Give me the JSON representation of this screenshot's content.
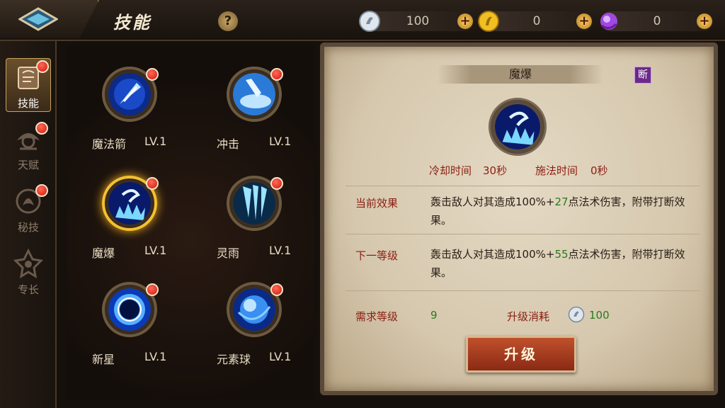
{
  "header": {
    "title": "技能",
    "help_label": "?",
    "currencies": [
      {
        "name": "silver",
        "value": "100",
        "color": "#cfd8e0"
      },
      {
        "name": "gold",
        "value": "0",
        "color": "#e8b820"
      },
      {
        "name": "gem",
        "value": "0",
        "color": "#9a40d0"
      }
    ],
    "plus_label": "+"
  },
  "sidebar": {
    "tabs": [
      {
        "label": "技能",
        "icon": "book-icon",
        "active": true
      },
      {
        "label": "天赋",
        "icon": "talent-icon",
        "active": false
      },
      {
        "label": "秘技",
        "icon": "secret-icon",
        "active": false
      },
      {
        "label": "专长",
        "icon": "specialty-icon",
        "active": false
      }
    ]
  },
  "skills": [
    {
      "name": "魔法箭",
      "level": "LV.1",
      "icon": "magic-arrow-icon"
    },
    {
      "name": "冲击",
      "level": "LV.1",
      "icon": "impact-icon"
    },
    {
      "name": "魔爆",
      "level": "LV.1",
      "icon": "magic-burst-icon",
      "selected": true
    },
    {
      "name": "灵雨",
      "level": "LV.1",
      "icon": "spirit-rain-icon"
    },
    {
      "name": "新星",
      "level": "LV.1",
      "icon": "nova-icon"
    },
    {
      "name": "元素球",
      "level": "LV.1",
      "icon": "element-orb-icon"
    }
  ],
  "detail": {
    "skill_name": "魔爆",
    "tag": "断",
    "cooldown_label": "冷却时间",
    "cooldown_value": "30秒",
    "cast_label": "施法时间",
    "cast_value": "0秒",
    "current_label": "当前效果",
    "current_pre": "轰击敌人对其造成100%+",
    "current_hl": "27",
    "current_post": "点法术伤害，附带打断效果。",
    "next_label": "下一等级",
    "next_pre": "轰击敌人对其造成100%+",
    "next_hl": "55",
    "next_post": "点法术伤害，附带打断效果。",
    "req_label": "需求等级",
    "req_value": "9",
    "cost_label": "升级消耗",
    "cost_value": "100",
    "upgrade_label": "升级"
  }
}
